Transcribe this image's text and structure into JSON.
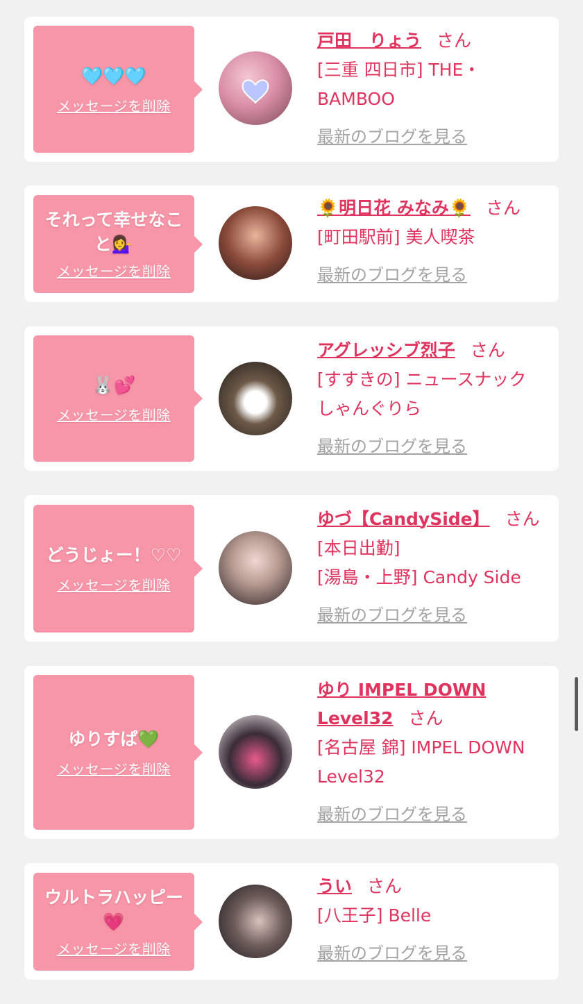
{
  "delete_label": "メッセージを削除",
  "blog_label": "最新のブログを見る",
  "honorific": "さん",
  "colors": {
    "background": "#f1f1f1",
    "card": "#ffffff",
    "bubble": "#f796a8",
    "accent": "#e0335e",
    "link_gray": "#a3a3a3"
  },
  "items": [
    {
      "message": "🩵🩵🩵",
      "name": "戸田　りょう",
      "shop_lines": [
        "[三重 四日市] THE・",
        "BAMBOO"
      ]
    },
    {
      "message": "それって幸せなこと💁‍♀️",
      "name": "🌻明日花 みなみ🌻",
      "shop_lines": [
        "[町田駅前] 美人喫茶"
      ]
    },
    {
      "message": "🐰💕",
      "name": "アグレッシブ烈子",
      "shop_lines": [
        "[すすきの] ニュースナック",
        "しゃんぐりら"
      ]
    },
    {
      "message": "どうじょー！♡♡",
      "name": "ゆづ【CandySide】",
      "shop_lines": [
        "[本日出勤]",
        "[湯島・上野] Candy Side"
      ]
    },
    {
      "message": "ゆりすぱ💚",
      "name": "ゆり IMPEL DOWN Level32",
      "shop_lines": [
        "[名古屋 錦] IMPEL DOWN",
        "Level32"
      ]
    },
    {
      "message": "ウルトラハッピー💗",
      "name": "うい",
      "shop_lines": [
        "[八王子] Belle"
      ]
    }
  ]
}
